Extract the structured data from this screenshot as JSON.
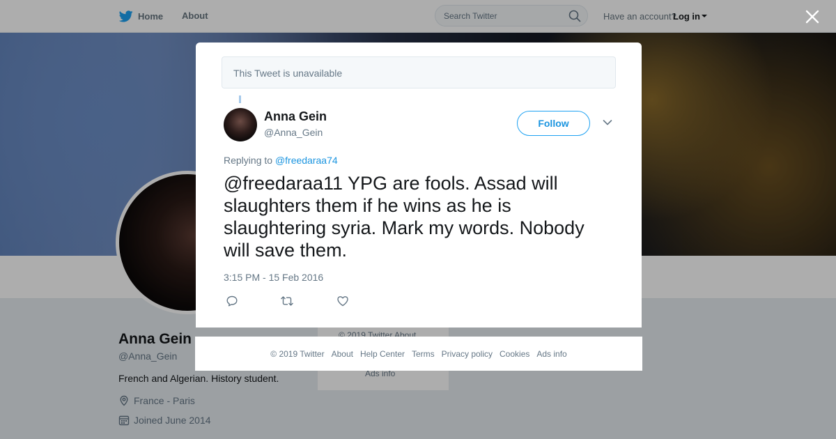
{
  "topbar": {
    "home_label": "Home",
    "about_label": "About",
    "search_placeholder": "Search Twitter",
    "account_text": "Have an account?",
    "login_label": "Log in"
  },
  "profile": {
    "name": "Anna Gein",
    "handle": "@Anna_Gein",
    "bio": "French and Algerian. History student.",
    "location": "France - Paris",
    "joined": "Joined June 2014"
  },
  "side_card": {
    "line1": "© 2019 Twitter  About",
    "line2": "Ads info"
  },
  "modal": {
    "unavailable_text": "This Tweet is unavailable",
    "tweet": {
      "author_name": "Anna Gein",
      "author_handle": "@Anna_Gein",
      "follow_label": "Follow",
      "replying_prefix": "Replying to",
      "replying_to": "@freedaraa74",
      "text": "@freedaraa11 YPG are fools. Assad will slaughters them if he wins as he is slaughtering syria. Mark my words. Nobody will save them.",
      "timestamp": "3:15 PM - 15 Feb 2016"
    }
  },
  "footer": {
    "links": [
      "© 2019 Twitter",
      "About",
      "Help Center",
      "Terms",
      "Privacy policy",
      "Cookies",
      "Ads info"
    ]
  },
  "icons": {
    "bird": "twitter-bird-icon",
    "search": "search-icon",
    "close": "close-icon",
    "location": "location-pin-icon",
    "calendar": "calendar-icon",
    "reply": "reply-icon",
    "retweet": "retweet-icon",
    "like": "heart-icon",
    "more": "chevron-down-icon"
  },
  "colors": {
    "accent": "#1da1f2",
    "link": "#1b95e0",
    "muted": "#657786"
  }
}
